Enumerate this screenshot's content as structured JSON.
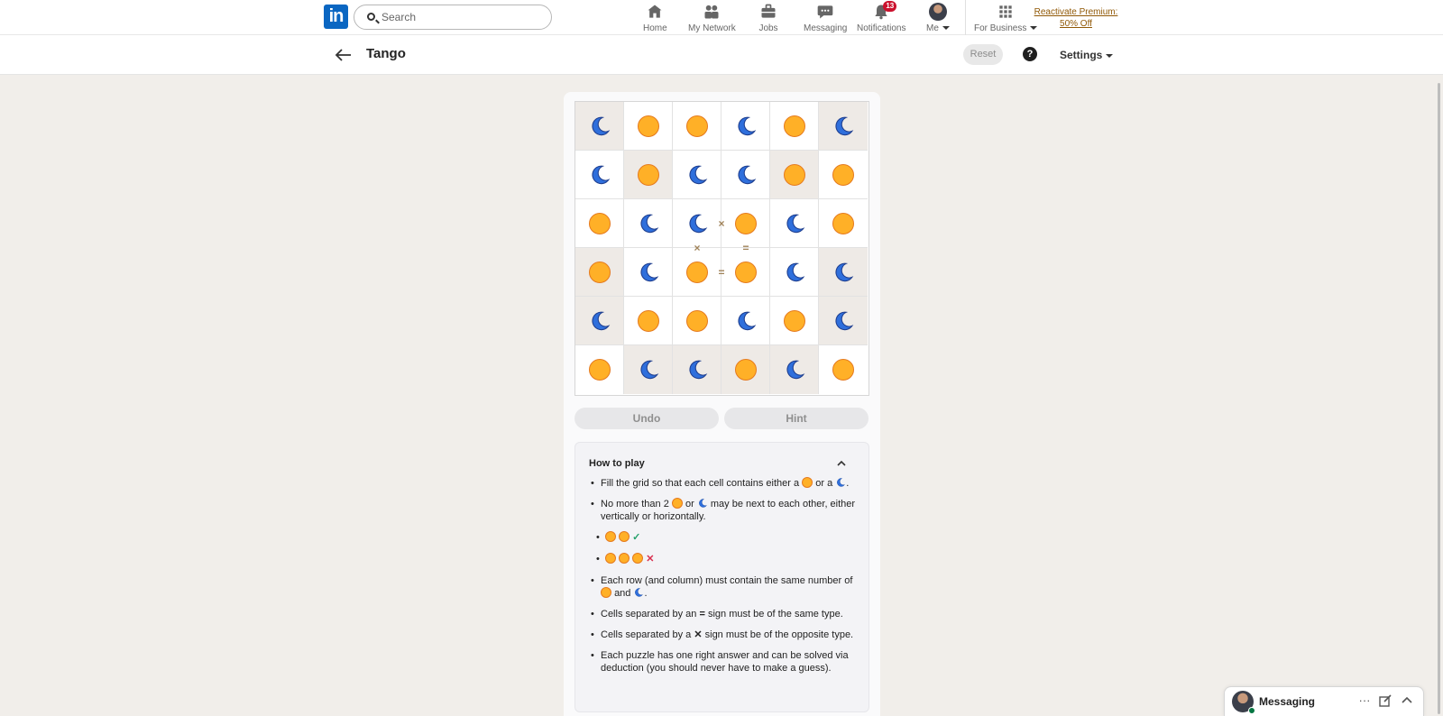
{
  "nav": {
    "search_placeholder": "Search",
    "items": [
      {
        "label": "Home",
        "icon": "home-icon"
      },
      {
        "label": "My Network",
        "icon": "network-icon"
      },
      {
        "label": "Jobs",
        "icon": "briefcase-icon"
      },
      {
        "label": "Messaging",
        "icon": "chat-icon"
      },
      {
        "label": "Notifications",
        "icon": "bell-icon",
        "badge": "13"
      },
      {
        "label": "Me",
        "icon": "avatar"
      },
      {
        "label": "For Business",
        "icon": "apps-grid-icon"
      }
    ],
    "premium_line1": "Reactivate Premium:",
    "premium_line2": "50% Off"
  },
  "header": {
    "title": "Tango",
    "reset_label": "Reset",
    "help_label": "?",
    "settings_label": "Settings"
  },
  "board": {
    "rows": [
      [
        "moon",
        "sun",
        "sun",
        "moon",
        "sun",
        "moon"
      ],
      [
        "moon",
        "sun",
        "moon",
        "moon",
        "sun",
        "sun"
      ],
      [
        "sun",
        "moon",
        "moon",
        "sun",
        "moon",
        "sun"
      ],
      [
        "sun",
        "moon",
        "sun",
        "sun",
        "moon",
        "moon"
      ],
      [
        "moon",
        "sun",
        "sun",
        "moon",
        "sun",
        "moon"
      ],
      [
        "sun",
        "moon",
        "moon",
        "sun",
        "moon",
        "sun"
      ]
    ],
    "locked": [
      [
        true,
        false,
        false,
        false,
        false,
        true
      ],
      [
        false,
        true,
        false,
        false,
        true,
        false
      ],
      [
        false,
        false,
        false,
        false,
        false,
        false
      ],
      [
        true,
        false,
        false,
        false,
        false,
        true
      ],
      [
        true,
        false,
        false,
        false,
        false,
        true
      ],
      [
        false,
        true,
        true,
        true,
        true,
        false
      ]
    ],
    "constraints": [
      {
        "symbol": "×",
        "between": [
          [
            2,
            2
          ],
          [
            2,
            3
          ]
        ]
      },
      {
        "symbol": "×",
        "between": [
          [
            2,
            2
          ],
          [
            3,
            2
          ]
        ]
      },
      {
        "symbol": "=",
        "between": [
          [
            2,
            3
          ],
          [
            3,
            3
          ]
        ]
      },
      {
        "symbol": "=",
        "between": [
          [
            3,
            2
          ],
          [
            3,
            3
          ]
        ]
      }
    ]
  },
  "controls": {
    "undo_label": "Undo",
    "hint_label": "Hint"
  },
  "how_to_play": {
    "title": "How to play",
    "rule1_pre": "Fill the grid so that each cell contains either a",
    "rule1_or": "or a",
    "rule1_end": ".",
    "rule2_pre": "No more than 2",
    "rule2_or": "or",
    "rule2_post": "may be next to each other, either vertically or horizontally.",
    "check_mark": "✓",
    "cross_mark": "✕",
    "rule3_pre": "Each row (and column) must contain the same number of",
    "rule3_and": "and",
    "rule3_end": ".",
    "rule4_pre": "Cells separated by an",
    "rule4_sym": "=",
    "rule4_post": "sign must be of the same type.",
    "rule5_pre": "Cells separated by a",
    "rule5_sym": "✕",
    "rule5_post": "sign must be of the opposite type.",
    "rule6": "Each puzzle has one right answer and can be solved via deduction (you should never have to make a guess)."
  },
  "messaging_dock": {
    "label": "Messaging",
    "more": "···"
  },
  "colors": {
    "brand": "#0a66c2",
    "sun": "#ffb027",
    "moon": "#2f6fdc",
    "locked_cell": "#eeeae6"
  }
}
